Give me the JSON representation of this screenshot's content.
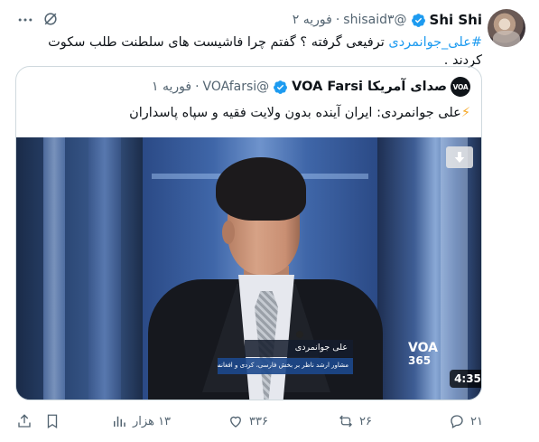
{
  "author": {
    "name": "Shi Shi",
    "handle": "@shisaid۳",
    "separator": "·",
    "date": "فوریه ۲"
  },
  "tweet": {
    "hashtag": "#علی_جوانمردی",
    "body": " ترفیعی گرفته ؟ گفتم چرا فاشیست های سلطنت طلب سکوت کردند ."
  },
  "quote": {
    "logo_text": "VOA",
    "name": "صدای آمریکا VOA Farsi",
    "handle": "@VOAfarsi",
    "separator": "·",
    "date": "فوریه ۱",
    "bolt": "⚡",
    "text": "علی جوانمردی: ایران آینده بدون ولایت فقیه و سپاه پاسداران",
    "video": {
      "lower_third_name": "علی جوانمردی",
      "lower_third_title": "مشاور ارشد ناظر بر بخش فارسی، کردی و افغانستان در صدای آمریکا",
      "channel_bug_top": "VOA",
      "channel_bug_bottom": "365",
      "duration": "4:35"
    }
  },
  "actions": {
    "replies": "۲۱",
    "reposts": "۲۶",
    "likes": "۳۳۶",
    "views": "۱۳ هزار"
  },
  "colors": {
    "accent": "#1d9bf0",
    "muted": "#536471",
    "text": "#0f1419",
    "border": "#cfd9de"
  }
}
